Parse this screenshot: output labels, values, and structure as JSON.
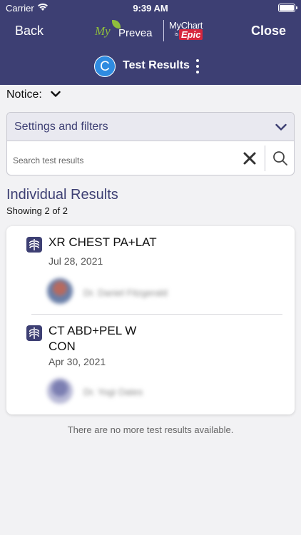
{
  "status_bar": {
    "carrier": "Carrier",
    "time": "9:39 AM"
  },
  "header": {
    "back_label": "Back",
    "close_label": "Close",
    "logo": {
      "my": "My",
      "prevea": "Prevea",
      "mychart": "MyChart",
      "is": "is",
      "epic": "Epic"
    },
    "avatar_initial": "C",
    "title": "Test Results"
  },
  "notice": {
    "label": "Notice:"
  },
  "filters": {
    "title": "Settings and filters",
    "search_placeholder": "Search test results"
  },
  "results_section": {
    "title": "Individual Results",
    "showing": "Showing 2 of 2",
    "items": [
      {
        "name": "XR CHEST PA+LAT",
        "date": "Jul 28, 2021",
        "provider": "Dr. Daniel Fitzgerald"
      },
      {
        "name": "CT ABD+PEL W CON",
        "date": "Apr 30, 2021",
        "provider": "Dr. Yogi Oates"
      }
    ]
  },
  "footer_note": "There are no more test results available.",
  "colors": {
    "header_bg": "#3d3f73",
    "accent": "#3d3f73",
    "avatar": "#2f8be0",
    "epic_red": "#d7263d",
    "prevea_green": "#8fbf3c"
  }
}
